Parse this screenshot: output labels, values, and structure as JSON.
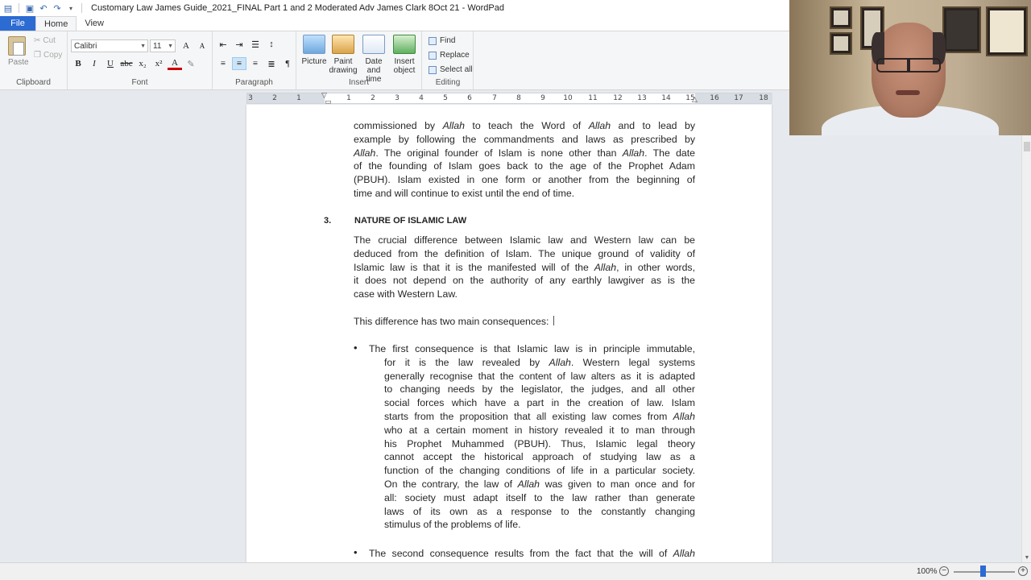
{
  "window": {
    "title": "Customary Law James Guide_2021_FINAL Part 1 and 2 Moderated Adv James Clark 8Oct  21 - WordPad"
  },
  "tabs": {
    "file": "File",
    "home": "Home",
    "view": "View"
  },
  "ribbon": {
    "clipboard": {
      "paste": "Paste",
      "cut": "Cut",
      "copy": "Copy",
      "label": "Clipboard"
    },
    "font": {
      "family": "Calibri",
      "size": "11",
      "label": "Font"
    },
    "paragraph": {
      "label": "Paragraph"
    },
    "insert": {
      "picture": "Picture",
      "paint_drawing_1": "Paint",
      "paint_drawing_2": "drawing",
      "date_time_1": "Date and",
      "date_time_2": "time",
      "insert_object_1": "Insert",
      "insert_object_2": "object",
      "label": "Insert"
    },
    "editing": {
      "find": "Find",
      "replace": "Replace",
      "select_all": "Select all",
      "label": "Editing"
    }
  },
  "ruler": {
    "numbers": [
      "3",
      "2",
      "1",
      "1",
      "2",
      "3",
      "4",
      "5",
      "6",
      "7",
      "8",
      "9",
      "10",
      "11",
      "12",
      "13",
      "14",
      "15",
      "16",
      "17",
      "18"
    ]
  },
  "document": {
    "para1_lines": [
      "commissioned by Allah to teach the Word of Allah and to lead by",
      "example by following the commandments and laws as prescribed by",
      "Allah. The original founder of Islam is none other than Allah. The date",
      "of the founding of Islam goes back to the age of the Prophet Adam",
      "(PBUH). Islam existed in one form or another from the beginning of",
      "time and will continue to exist until the end of time."
    ],
    "heading_num": "3.",
    "heading": "NATURE OF ISLAMIC LAW",
    "para2_lines": [
      "The crucial difference between Islamic law and Western law can be",
      "deduced from the definition of Islam. The unique ground of validity of",
      "Islamic law is that it is the manifested will of the Allah, in other words,",
      "it does not depend on the authority of any earthly lawgiver as is the",
      "case with Western Law."
    ],
    "para3": "This difference has two main consequences:",
    "bullet1_lines": [
      "The first consequence is that Islamic law is in principle immutable,",
      "for it is the law revealed by Allah. Western legal systems",
      "generally recognise that the content of law alters as it is adapted",
      "to changing needs by the legislator, the judges, and all other",
      "social forces which have a part in the creation of law. Islam",
      "starts from the proposition that all existing law comes from Allah",
      "who at a certain moment in history revealed it to man through",
      "his Prophet Muhammed (PBUH). Thus, Islamic legal theory",
      "cannot accept the historical approach of studying law as a",
      "function of the changing conditions of life in a particular society.",
      "On the contrary, the law of Allah was given to man once and for",
      "all: society must adapt itself to the law rather than generate",
      "laws of its own as a response to the constantly changing",
      "stimulus of the problems of life."
    ],
    "bullet2_line": "The second consequence results from the fact that the will of Allah"
  },
  "status": {
    "zoom": "100%",
    "minus": "−",
    "plus": "+"
  }
}
